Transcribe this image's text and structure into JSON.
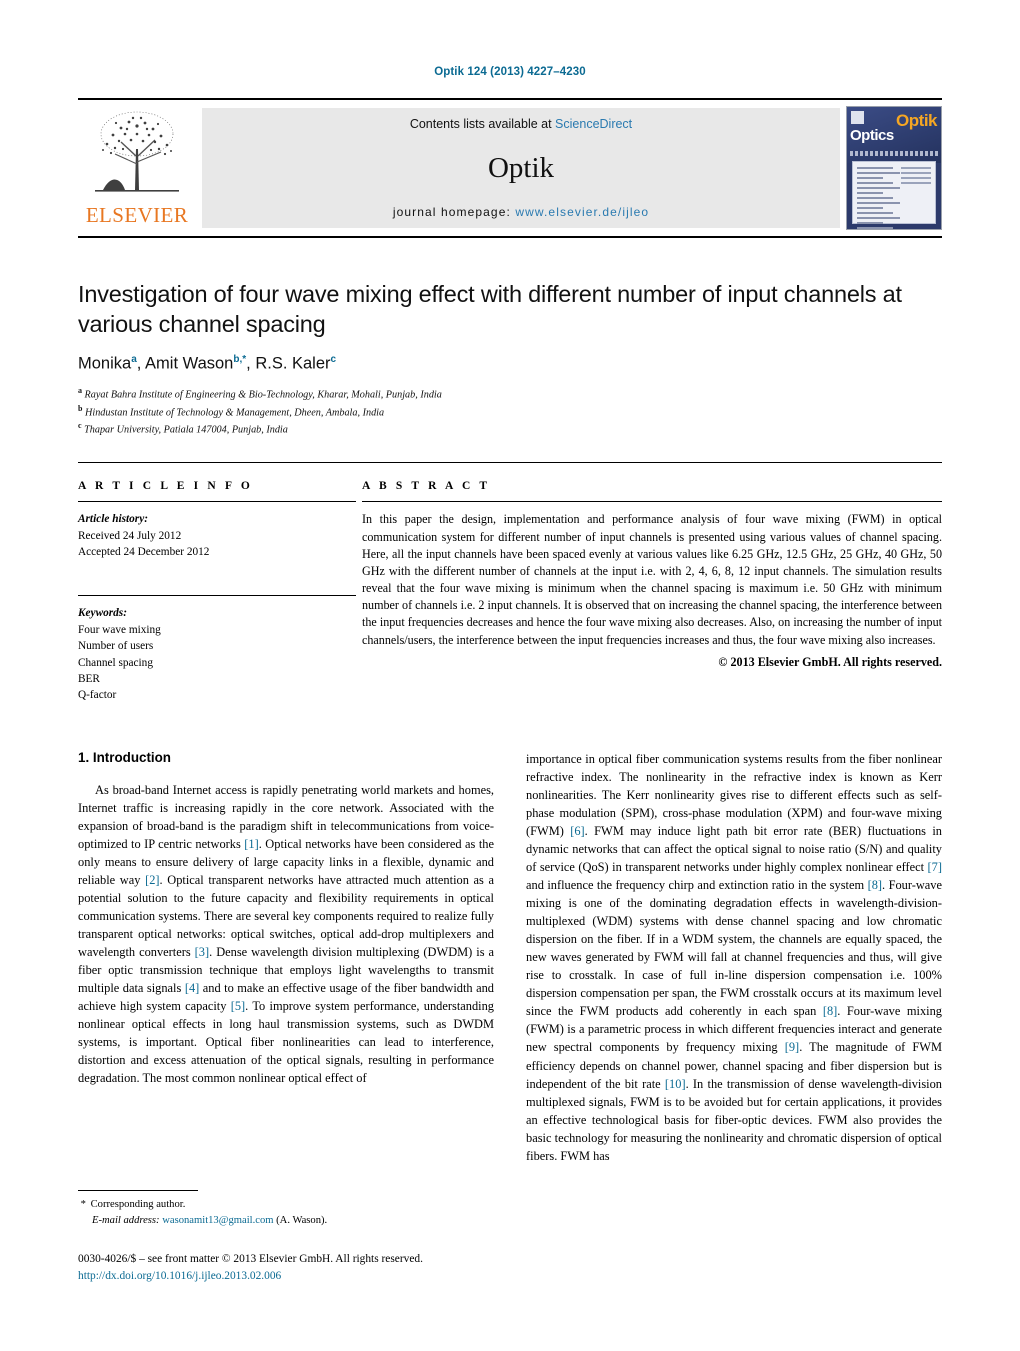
{
  "running_head": "Optik 124 (2013) 4227–4230",
  "masthead": {
    "publisher_name": "ELSEVIER",
    "contents_prefix": "Contents lists available at ",
    "contents_link": "ScienceDirect",
    "journal_name": "Optik",
    "homepage_prefix": "journal homepage: ",
    "homepage_url": "www.elsevier.de/ijleo",
    "cover": {
      "title_main": "Optik",
      "title_sub": "Optics"
    }
  },
  "article": {
    "title": "Investigation of four wave mixing effect with different number of input channels at various channel spacing",
    "authors": [
      {
        "name": "Monika",
        "marks": "a"
      },
      {
        "name": "Amit Wason",
        "marks": "b,*"
      },
      {
        "name": "R.S. Kaler",
        "marks": "c"
      }
    ],
    "affiliations": [
      {
        "mark": "a",
        "text": "Rayat Bahra Institute of Engineering & Bio-Technology, Kharar, Mohali, Punjab, India"
      },
      {
        "mark": "b",
        "text": "Hindustan Institute of Technology & Management, Dheen, Ambala, India"
      },
      {
        "mark": "c",
        "text": "Thapar University, Patiala 147004, Punjab, India"
      }
    ]
  },
  "info": {
    "heading": "A R T I C L E  I N F O",
    "history_label": "Article history:",
    "received": "Received 24 July 2012",
    "accepted": "Accepted 24 December 2012",
    "keywords_label": "Keywords:",
    "keywords": [
      "Four wave mixing",
      "Number of users",
      "Channel spacing",
      "BER",
      "Q-factor"
    ]
  },
  "abstract": {
    "heading": "A B S T R A C T",
    "text": "In this paper the design, implementation and performance analysis of four wave mixing (FWM) in optical communication system for different number of input channels is presented using various values of channel spacing. Here, all the input channels have been spaced evenly at various values like 6.25 GHz, 12.5 GHz, 25 GHz, 40 GHz, 50 GHz with the different number of channels at the input i.e. with 2, 4, 6, 8, 12 input channels. The simulation results reveal that the four wave mixing is minimum when the channel spacing is maximum i.e. 50 GHz with minimum number of channels i.e. 2 input channels. It is observed that on increasing the channel spacing, the interference between the input frequencies decreases and hence the four wave mixing also decreases. Also, on increasing the number of input channels/users, the interference between the input frequencies increases and thus, the four wave mixing also increases.",
    "copyright": "© 2013 Elsevier GmbH. All rights reserved."
  },
  "body": {
    "section_heading": "1. Introduction",
    "left_para_part1": "As broad-band Internet access is rapidly penetrating world markets and homes, Internet traffic is increasing rapidly in the core network. Associated with the expansion of broad-band is the paradigm shift in telecommunications from voice-optimized to IP centric networks ",
    "ref1": "[1]",
    "left_para_part2": ". Optical networks have been considered as the only means to ensure delivery of large capacity links in a flexible, dynamic and reliable way ",
    "ref2": "[2]",
    "left_para_part3": ". Optical transparent networks have attracted much attention as a potential solution to the future capacity and flexibility requirements in optical communication systems. There are several key components required to realize fully transparent optical networks: optical switches, optical add-drop multiplexers and wavelength converters ",
    "ref3": "[3]",
    "left_para_part4": ". Dense wavelength division multiplexing (DWDM) is a fiber optic transmission technique that employs light wavelengths to transmit multiple data signals ",
    "ref4": "[4]",
    "left_para_part5": " and to make an effective usage of the fiber bandwidth and achieve high system capacity ",
    "ref5": "[5]",
    "left_para_part6": ". To improve system performance, understanding nonlinear optical effects in long haul transmission systems, such as DWDM systems, is important. Optical fiber nonlinearities can lead to interference, distortion and excess attenuation of the optical signals, resulting in performance degradation. The most common nonlinear optical effect of",
    "right_para_part1": "importance in optical fiber communication systems results from the fiber nonlinear refractive index. The nonlinearity in the refractive index is known as Kerr nonlinearities. The Kerr nonlinearity gives rise to different effects such as self-phase modulation (SPM), cross-phase modulation (XPM) and four-wave mixing (FWM) ",
    "ref6": "[6]",
    "right_para_part2": ". FWM may induce light path bit error rate (BER) fluctuations in dynamic networks that can affect the optical signal to noise ratio (S/N) and quality of service (QoS) in transparent networks under highly complex nonlinear effect ",
    "ref7": "[7]",
    "right_para_part3": " and influence the frequency chirp and extinction ratio in the system ",
    "ref8": "[8]",
    "right_para_part4": ". Four-wave mixing is one of the dominating degradation effects in wavelength-division-multiplexed (WDM) systems with dense channel spacing and low chromatic dispersion on the fiber. If in a WDM system, the channels are equally spaced, the new waves generated by FWM will fall at channel frequencies and thus, will give rise to crosstalk. In case of full in-line dispersion compensation i.e. 100% dispersion compensation per span, the FWM crosstalk occurs at its maximum level since the FWM products add coherently in each span ",
    "ref8b": "[8]",
    "right_para_part5": ". Four-wave mixing (FWM) is a parametric process in which different frequencies interact and generate new spectral components by frequency mixing ",
    "ref9": "[9]",
    "right_para_part6": ". The magnitude of FWM efficiency depends on channel power, channel spacing and fiber dispersion but is independent of the bit rate ",
    "ref10": "[10]",
    "right_para_part7": ". In the transmission of dense wavelength-division multiplexed signals, FWM is to be avoided but for certain applications, it provides an effective technological basis for fiber-optic devices. FWM also provides the basic technology for measuring the nonlinearity and chromatic dispersion of optical fibers. FWM has"
  },
  "footer": {
    "corresponding_marker": "*",
    "corresponding_label": "Corresponding author.",
    "email_label": "E-mail address:",
    "email": "wasonamit13@gmail.com",
    "email_owner": "(A. Wason).",
    "front_matter": "0030-4026/$ – see front matter © 2013 Elsevier GmbH. All rights reserved.",
    "doi": "http://dx.doi.org/10.1016/j.ijleo.2013.02.006"
  },
  "colors": {
    "link": "#0b6a92",
    "elsevier_orange": "#e87722",
    "band_gray": "#e8e8e8"
  }
}
